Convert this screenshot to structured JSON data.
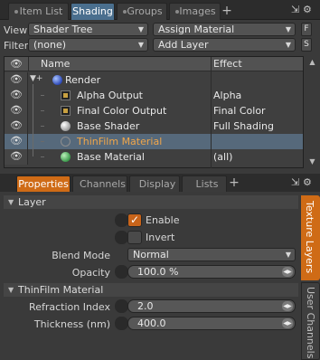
{
  "top_tabs": [
    {
      "label": "Item List",
      "active": false
    },
    {
      "label": "Shading",
      "active": true
    },
    {
      "label": "Groups",
      "active": false
    },
    {
      "label": "Images",
      "active": false
    }
  ],
  "top_tabs_plus": "+",
  "view": {
    "label": "View",
    "value": "Shader Tree",
    "action": "Assign Material",
    "side_button": "F"
  },
  "filter": {
    "label": "Filter",
    "value": "(none)",
    "action": "Add Layer",
    "side_button": "S"
  },
  "tree": {
    "columns": {
      "name": "Name",
      "effect": "Effect"
    },
    "rows": [
      {
        "name": "Render",
        "effect": "",
        "icon": "sphere-blue-icon",
        "selected": false
      },
      {
        "name": "Alpha Output",
        "effect": "Alpha",
        "icon": "texture-layer-icon",
        "selected": false
      },
      {
        "name": "Final Color Output",
        "effect": "Final Color",
        "icon": "texture-layer-icon",
        "selected": false
      },
      {
        "name": "Base Shader",
        "effect": "Full Shading",
        "icon": "sphere-white-icon",
        "selected": false
      },
      {
        "name": "ThinFilm Material",
        "effect": "",
        "icon": "sphere-empty-icon",
        "selected": true
      },
      {
        "name": "Base Material",
        "effect": "(all)",
        "icon": "sphere-green-icon",
        "selected": false
      }
    ],
    "expander": "▼+"
  },
  "bottom_tabs": [
    {
      "label": "Properties",
      "active": true
    },
    {
      "label": "Channels",
      "active": false
    },
    {
      "label": "Display",
      "active": false
    },
    {
      "label": "Lists",
      "active": false
    }
  ],
  "bottom_tabs_plus": "+",
  "properties": {
    "layer_section": "Layer",
    "enable_label": "Enable",
    "enable_checked": true,
    "invert_label": "Invert",
    "invert_checked": false,
    "blend_mode_label": "Blend Mode",
    "blend_mode_value": "Normal",
    "opacity_label": "Opacity",
    "opacity_value": "100.0 %",
    "thinfilm_section": "ThinFilm Material",
    "refraction_label": "Refraction Index",
    "refraction_value": "2.0",
    "thickness_label": "Thickness (nm)",
    "thickness_value": "400.0"
  },
  "side_tabs": [
    {
      "label": "Texture Layers",
      "active": true
    },
    {
      "label": "User Channels",
      "active": false
    }
  ],
  "colors": {
    "accent_orange": "#cf6b16",
    "tab_blue": "#4a6f8e",
    "selection": "#56697b"
  }
}
